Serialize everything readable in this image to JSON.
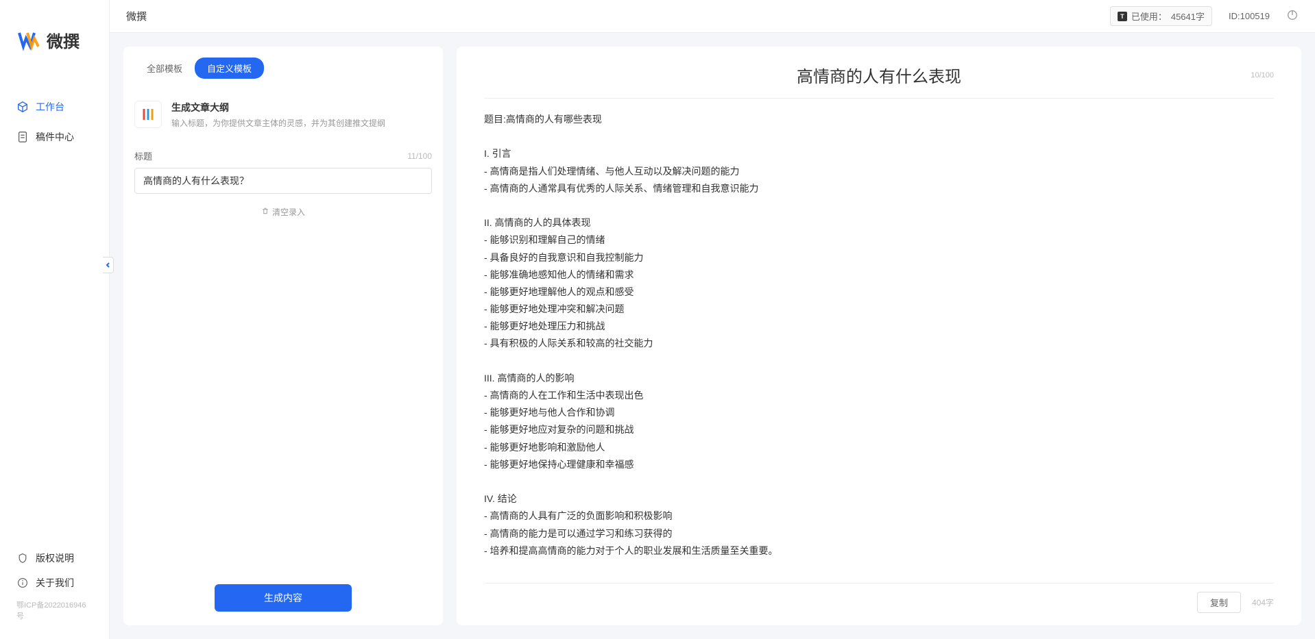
{
  "app": {
    "name": "微撰",
    "logo_text": "微撰"
  },
  "topbar": {
    "title": "微撰",
    "usage_label": "已使用：",
    "usage_value": "45641字",
    "id_label": "ID:100519"
  },
  "sidebar": {
    "nav": [
      {
        "label": "工作台",
        "active": true,
        "icon": "cube"
      },
      {
        "label": "稿件中心",
        "active": false,
        "icon": "doc"
      }
    ],
    "bottom": [
      {
        "label": "版权说明",
        "icon": "shield"
      },
      {
        "label": "关于我们",
        "icon": "info"
      }
    ],
    "icp": "鄂ICP备2022016946号"
  },
  "left_panel": {
    "tabs": [
      {
        "label": "全部模板",
        "active": false
      },
      {
        "label": "自定义模板",
        "active": true
      }
    ],
    "template": {
      "title": "生成文章大纲",
      "desc": "输入标题，为你提供文章主体的灵感，并为其创建推文提纲"
    },
    "form": {
      "title_label": "标题",
      "title_count": "11/100",
      "title_value": "高情商的人有什么表现？",
      "clear_label": "清空录入"
    },
    "generate_btn": "生成内容"
  },
  "right_panel": {
    "title": "高情商的人有什么表现",
    "title_count": "10/100",
    "content": "题目:高情商的人有哪些表现\n\nI. 引言\n- 高情商是指人们处理情绪、与他人互动以及解决问题的能力\n- 高情商的人通常具有优秀的人际关系、情绪管理和自我意识能力\n\nII. 高情商的人的具体表现\n- 能够识别和理解自己的情绪\n- 具备良好的自我意识和自我控制能力\n- 能够准确地感知他人的情绪和需求\n- 能够更好地理解他人的观点和感受\n- 能够更好地处理冲突和解决问题\n- 能够更好地处理压力和挑战\n- 具有积极的人际关系和较高的社交能力\n\nIII. 高情商的人的影响\n- 高情商的人在工作和生活中表现出色\n- 能够更好地与他人合作和协调\n- 能够更好地应对复杂的问题和挑战\n- 能够更好地影响和激励他人\n- 能够更好地保持心理健康和幸福感\n\nIV. 结论\n- 高情商的人具有广泛的负面影响和积极影响\n- 高情商的能力是可以通过学习和练习获得的\n- 培养和提高高情商的能力对于个人的职业发展和生活质量至关重要。",
    "copy_btn": "复制",
    "word_count": "404字"
  }
}
